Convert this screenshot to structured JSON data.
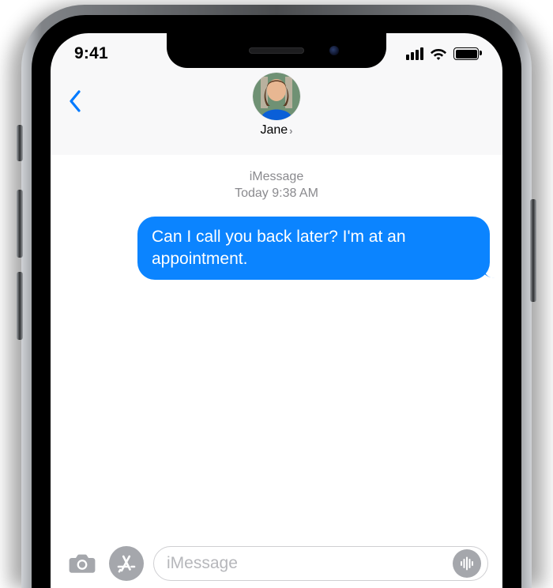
{
  "statusbar": {
    "time": "9:41"
  },
  "header": {
    "contact_name": "Jane"
  },
  "thread": {
    "service": "iMessage",
    "timestamp": "Today 9:38 AM",
    "messages": [
      {
        "from": "me",
        "text": "Can I call you back later? I'm at an appointment."
      }
    ]
  },
  "input": {
    "placeholder": "iMessage"
  },
  "colors": {
    "accent": "#007aff",
    "bubble_sent": "#0b84ff"
  }
}
